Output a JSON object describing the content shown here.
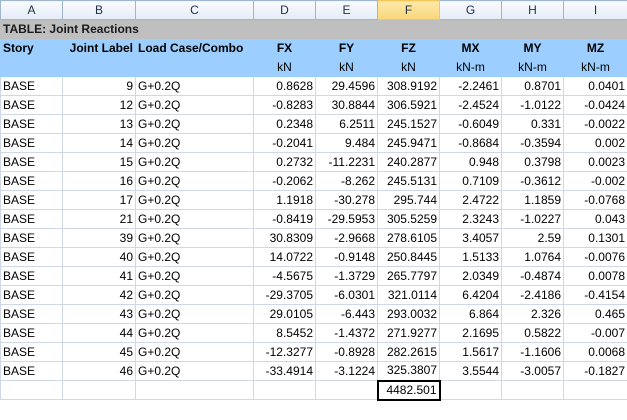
{
  "columns": [
    "A",
    "B",
    "C",
    "D",
    "E",
    "F",
    "G",
    "H",
    "I"
  ],
  "selected_column": "F",
  "table_title": "TABLE:  Joint Reactions",
  "headers": [
    "Story",
    "Joint Label",
    "Load Case/Combo",
    "FX",
    "FY",
    "FZ",
    "MX",
    "MY",
    "MZ"
  ],
  "units": [
    "",
    "",
    "",
    "kN",
    "kN",
    "kN",
    "kN-m",
    "kN-m",
    "kN-m"
  ],
  "rows": [
    [
      "BASE",
      "9",
      "G+0.2Q",
      "0.8628",
      "29.4596",
      "308.9192",
      "-2.2461",
      "0.8701",
      "0.0401"
    ],
    [
      "BASE",
      "12",
      "G+0.2Q",
      "-0.8283",
      "30.8844",
      "306.5921",
      "-2.4524",
      "-1.0122",
      "-0.0424"
    ],
    [
      "BASE",
      "13",
      "G+0.2Q",
      "0.2348",
      "6.2511",
      "245.1527",
      "-0.6049",
      "0.331",
      "-0.0022"
    ],
    [
      "BASE",
      "14",
      "G+0.2Q",
      "-0.2041",
      "9.484",
      "245.9471",
      "-0.8684",
      "-0.3594",
      "0.002"
    ],
    [
      "BASE",
      "15",
      "G+0.2Q",
      "0.2732",
      "-11.2231",
      "240.2877",
      "0.948",
      "0.3798",
      "0.0023"
    ],
    [
      "BASE",
      "16",
      "G+0.2Q",
      "-0.2062",
      "-8.262",
      "245.5131",
      "0.7109",
      "-0.3612",
      "-0.002"
    ],
    [
      "BASE",
      "17",
      "G+0.2Q",
      "1.1918",
      "-30.278",
      "295.744",
      "2.4722",
      "1.1859",
      "-0.0768"
    ],
    [
      "BASE",
      "21",
      "G+0.2Q",
      "-0.8419",
      "-29.5953",
      "305.5259",
      "2.3243",
      "-1.0227",
      "0.043"
    ],
    [
      "BASE",
      "39",
      "G+0.2Q",
      "30.8309",
      "-2.9668",
      "278.6105",
      "3.4057",
      "2.59",
      "0.1301"
    ],
    [
      "BASE",
      "40",
      "G+0.2Q",
      "14.0722",
      "-0.9148",
      "250.8445",
      "1.5133",
      "1.0764",
      "-0.0076"
    ],
    [
      "BASE",
      "41",
      "G+0.2Q",
      "-4.5675",
      "-1.3729",
      "265.7797",
      "2.0349",
      "-0.4874",
      "0.0078"
    ],
    [
      "BASE",
      "42",
      "G+0.2Q",
      "-29.3705",
      "-6.0301",
      "321.0114",
      "6.4204",
      "-2.4186",
      "-0.4154"
    ],
    [
      "BASE",
      "43",
      "G+0.2Q",
      "29.0105",
      "-6.443",
      "293.0032",
      "6.864",
      "2.326",
      "0.465"
    ],
    [
      "BASE",
      "44",
      "G+0.2Q",
      "8.5452",
      "-1.4372",
      "271.9277",
      "2.1695",
      "0.5822",
      "-0.007"
    ],
    [
      "BASE",
      "45",
      "G+0.2Q",
      "-12.3277",
      "-0.8928",
      "282.2615",
      "1.5617",
      "-1.1606",
      "0.0068"
    ],
    [
      "BASE",
      "46",
      "G+0.2Q",
      "-33.4914",
      "-3.1224",
      "325.3807",
      "3.5544",
      "-3.0057",
      "-0.1827"
    ]
  ],
  "total_fz": "4482.501"
}
